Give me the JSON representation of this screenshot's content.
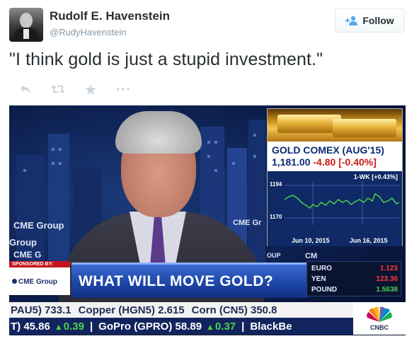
{
  "user": {
    "display_name": "Rudolf E. Havenstein",
    "screen_name": "@RudyHavenstein",
    "avatar_icon": "user-avatar-photo"
  },
  "follow_button": {
    "label": "Follow",
    "icon": "follow-person-plus-icon"
  },
  "tweet": {
    "text": "\"I think gold is just a stupid investment.\""
  },
  "actions": [
    {
      "name": "reply",
      "icon": "reply-icon"
    },
    {
      "name": "retweet",
      "icon": "retweet-icon"
    },
    {
      "name": "favorite",
      "icon": "star-icon"
    },
    {
      "name": "more",
      "icon": "more-dots-icon"
    }
  ],
  "media": {
    "gold_panel": {
      "title": "GOLD COMEX (AUG'15)",
      "price": "1,181.00",
      "change": "-4.80",
      "change_pct": "[-0.40%]",
      "chart_header": "1-WK [+0.43%]",
      "y_labels": [
        "1194",
        "1170"
      ],
      "x_labels": [
        "Jun 10, 2015",
        "Jun 16, 2015"
      ]
    },
    "background_logos": [
      "CME Group",
      "Group",
      "CME G",
      "CME Gr",
      "CM",
      "OUP"
    ],
    "sponsor": {
      "tag": "SPONSORED BY:",
      "logo": "CME Group"
    },
    "headline": "WHAT WILL MOVE GOLD?",
    "fx": [
      {
        "label": "EURO",
        "value": "1.123",
        "color": "#ff3b3b"
      },
      {
        "label": "YEN",
        "value": "123.36",
        "color": "#ff3b3b"
      },
      {
        "label": "POUND",
        "value": "1.5638",
        "color": "#4ad14a"
      }
    ],
    "ticker_top": [
      "PAU5) 733.1",
      "Copper (HGN5) 2.615",
      "Corn (CN5) 350.8"
    ],
    "ticker_bottom": [
      {
        "text": "T) 45.86",
        "change": "0.39"
      },
      {
        "text": "GoPro (GPRO) 58.89",
        "change": "0.37"
      },
      {
        "text": "BlackBe",
        "change": null
      }
    ],
    "network_logo": "CNBC"
  },
  "colors": {
    "twitter_text": "#292f33",
    "twitter_muted": "#8899a6",
    "follow_icon": "#55acee",
    "headline_blue": "#1d47a8",
    "gold_title": "#0b2c73",
    "negative": "#cc1c1c"
  }
}
